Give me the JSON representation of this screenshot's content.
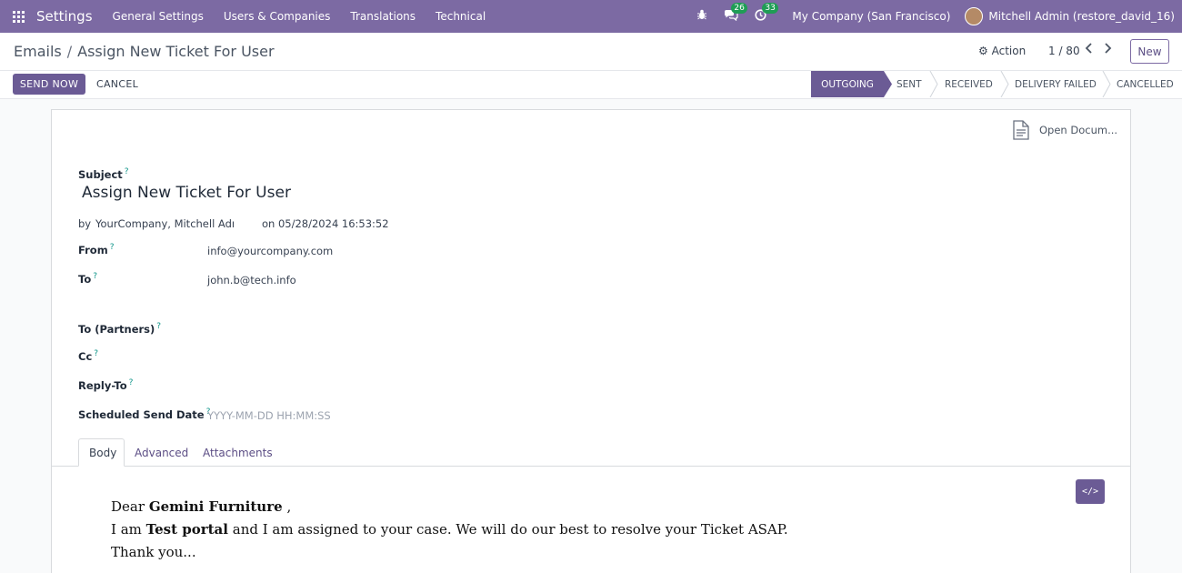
{
  "navbar": {
    "brand": "Settings",
    "menu": [
      "General Settings",
      "Users & Companies",
      "Translations",
      "Technical"
    ],
    "messages_count": "26",
    "activities_count": "33",
    "company": "My Company (San Francisco)",
    "user": "Mitchell Admin (restore_david_16)"
  },
  "control_panel": {
    "breadcrumb_parent": "Emails",
    "breadcrumb_separator": "/",
    "breadcrumb_current": "Assign New Ticket For User",
    "action_label": "Action",
    "pager": "1 / 80",
    "new_label": "New"
  },
  "statusbar": {
    "send_now": "SEND NOW",
    "cancel": "CANCEL",
    "stages": [
      "OUTGOING",
      "SENT",
      "RECEIVED",
      "DELIVERY FAILED",
      "CANCELLED"
    ],
    "active_stage": "OUTGOING"
  },
  "sheet": {
    "open_document": "Open Docum...",
    "subject_label": "Subject",
    "subject": "Assign New Ticket For User",
    "by_label": "by",
    "author": "YourCompany, Mitchell Admi",
    "date": "on 05/28/2024 16:53:52",
    "fields": {
      "from_label": "From",
      "from": "info@yourcompany.com",
      "to_label": "To",
      "to": "john.b@tech.info",
      "to_partners_label": "To (Partners)",
      "cc_label": "Cc",
      "reply_to_label": "Reply-To",
      "scheduled_label": "Scheduled Send Date",
      "scheduled_placeholder": "YYYY-MM-DD HH:MM:SS"
    },
    "help_mark": "?",
    "tabs": [
      "Body",
      "Advanced",
      "Attachments"
    ],
    "active_tab": "Body",
    "code_button": "</>",
    "body": {
      "line1_prefix": "Dear",
      "line1_name": "Gemini Furniture",
      "line1_suffix": ",",
      "line2_prefix": "I am",
      "line2_name": "Test portal",
      "line2_suffix": "and I am assigned to your case. We will do our best to resolve your Ticket ASAP.",
      "line3": "Thank you..."
    }
  },
  "colors": {
    "navbar": "#7c6aa3",
    "primary": "#6b5b95",
    "badge": "#1f9d55"
  }
}
